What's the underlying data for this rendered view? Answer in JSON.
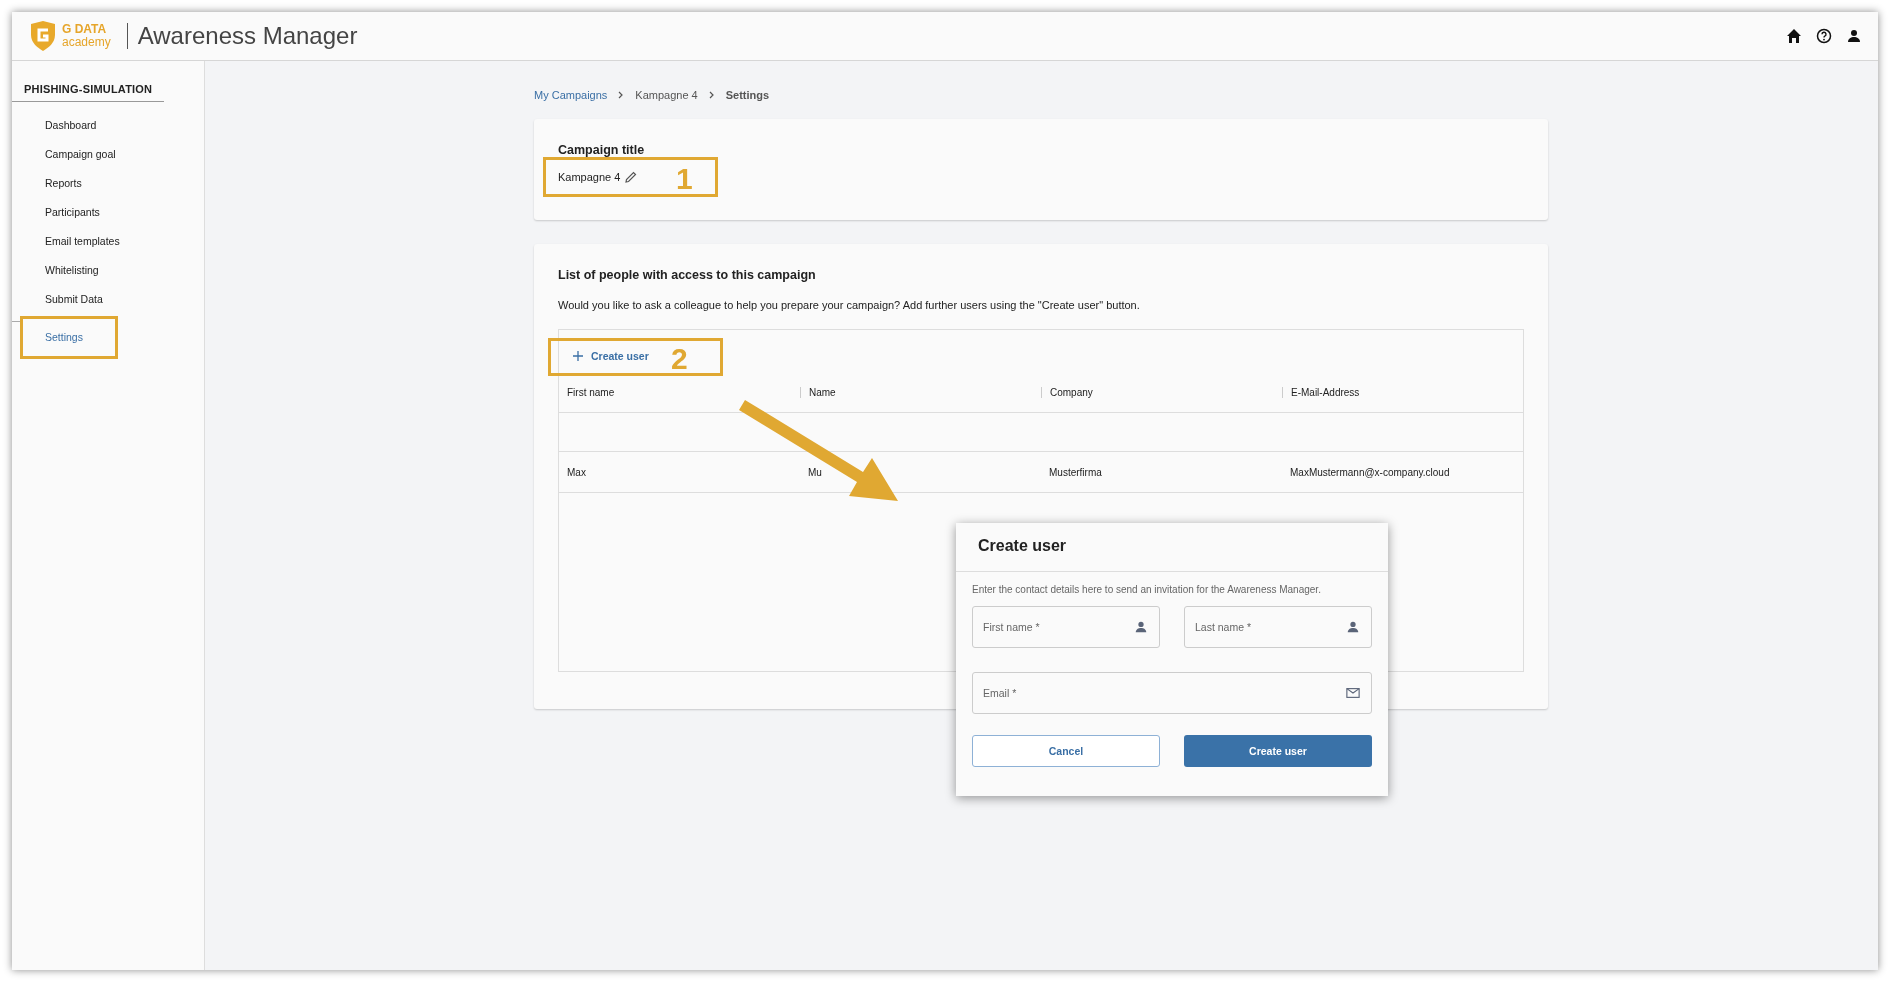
{
  "header": {
    "logo_top": "G DATA",
    "logo_bottom": "academy",
    "title": "Awareness Manager"
  },
  "sidebar": {
    "section": "PHISHING-SIMULATION",
    "items": [
      {
        "label": "Dashboard",
        "selected": false,
        "highlighted": false
      },
      {
        "label": "Campaign goal",
        "selected": false,
        "highlighted": false
      },
      {
        "label": "Reports",
        "selected": false,
        "highlighted": false
      },
      {
        "label": "Participants",
        "selected": false,
        "highlighted": false
      },
      {
        "label": "Email templates",
        "selected": false,
        "highlighted": false
      },
      {
        "label": "Whitelisting",
        "selected": false,
        "highlighted": false
      },
      {
        "label": "Submit Data",
        "selected": false,
        "highlighted": false
      },
      {
        "label": "Settings",
        "selected": true,
        "highlighted": true
      }
    ]
  },
  "breadcrumb": [
    {
      "label": "My Campaigns",
      "kind": "link"
    },
    {
      "label": "Kampagne 4",
      "kind": "text"
    },
    {
      "label": "Settings",
      "kind": "current"
    }
  ],
  "title_card": {
    "heading": "Campaign title",
    "value": "Kampagne 4",
    "annotation": "1"
  },
  "access_card": {
    "heading": "List of people with access to this campaign",
    "description": "Would you like to ask a colleague to help you prepare your campaign? Add further users using the \"Create user\" button.",
    "create_button": {
      "label": "Create user",
      "annotation": "2"
    },
    "table": {
      "columns": [
        "First name",
        "Name",
        "Company",
        "E-Mail-Address"
      ],
      "rows": [
        [
          "Max",
          "Mu",
          "Musterfirma",
          "MaxMustermann@x-company.cloud"
        ]
      ]
    }
  },
  "dialog": {
    "title": "Create user",
    "intro": "Enter the contact details here to send an invitation for the Awareness Manager.",
    "fields": [
      {
        "placeholder": "First name *",
        "kind": "name",
        "full_width": false
      },
      {
        "placeholder": "Last name *",
        "kind": "name",
        "full_width": false
      },
      {
        "placeholder": "Email *",
        "kind": "email",
        "full_width": true
      }
    ],
    "buttons": [
      {
        "label": "Cancel",
        "kind": "secondary"
      },
      {
        "label": "Create user",
        "kind": "primary"
      }
    ]
  }
}
